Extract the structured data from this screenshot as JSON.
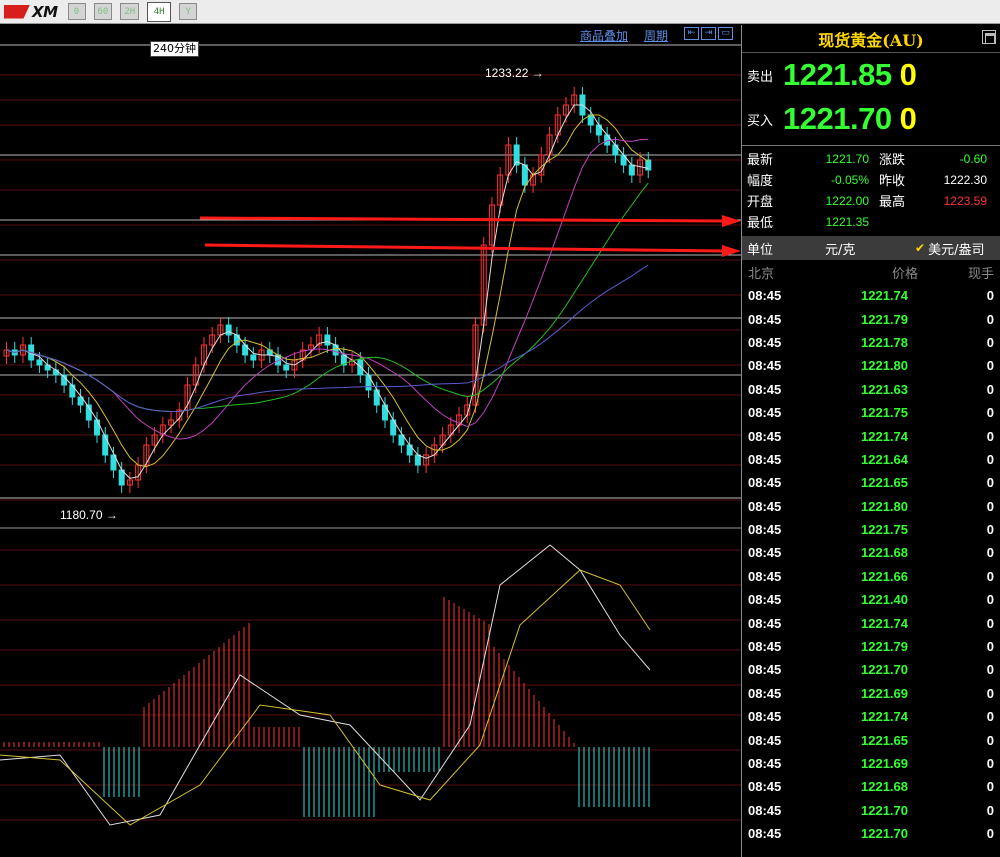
{
  "app": {
    "logo_text": "XM"
  },
  "toolbar": {
    "buttons": [
      "0",
      "60",
      "2H",
      "4H",
      "Y"
    ],
    "active": "4H"
  },
  "chart": {
    "period_tip": "240分钟",
    "links": [
      "商品叠加",
      "周期"
    ],
    "icon_names": [
      "scroll-left-icon",
      "scroll-right-icon",
      "zoom-out-icon"
    ],
    "high_label": "1233.22",
    "low_label": "1180.70"
  },
  "panel": {
    "title": "现货黄金(AU)",
    "sell_label": "卖出",
    "sell_price": "1221.85",
    "sell_vol": "0",
    "buy_label": "买入",
    "buy_price": "1221.70",
    "buy_vol": "0",
    "stats": {
      "latest_label": "最新",
      "latest": "1221.70",
      "change_label": "涨跌",
      "change": "-0.60",
      "range_label": "幅度",
      "range": "-0.05%",
      "prev_close_label": "昨收",
      "prev_close": "1222.30",
      "open_label": "开盘",
      "open": "1222.00",
      "high_label": "最高",
      "high": "1223.59",
      "low_label": "最低",
      "low": "1221.35"
    },
    "unit": {
      "label": "单位",
      "yuan": "元/克",
      "usd": "美元/盎司"
    },
    "tick_header": {
      "time": "北京",
      "price": "价格",
      "vol": "现手"
    },
    "ticks": [
      {
        "time": "08:45",
        "price": "1221.74",
        "vol": "0"
      },
      {
        "time": "08:45",
        "price": "1221.79",
        "vol": "0"
      },
      {
        "time": "08:45",
        "price": "1221.78",
        "vol": "0"
      },
      {
        "time": "08:45",
        "price": "1221.80",
        "vol": "0"
      },
      {
        "time": "08:45",
        "price": "1221.63",
        "vol": "0"
      },
      {
        "time": "08:45",
        "price": "1221.75",
        "vol": "0"
      },
      {
        "time": "08:45",
        "price": "1221.74",
        "vol": "0"
      },
      {
        "time": "08:45",
        "price": "1221.64",
        "vol": "0"
      },
      {
        "time": "08:45",
        "price": "1221.65",
        "vol": "0"
      },
      {
        "time": "08:45",
        "price": "1221.80",
        "vol": "0"
      },
      {
        "time": "08:45",
        "price": "1221.75",
        "vol": "0"
      },
      {
        "time": "08:45",
        "price": "1221.68",
        "vol": "0"
      },
      {
        "time": "08:45",
        "price": "1221.66",
        "vol": "0"
      },
      {
        "time": "08:45",
        "price": "1221.40",
        "vol": "0"
      },
      {
        "time": "08:45",
        "price": "1221.74",
        "vol": "0"
      },
      {
        "time": "08:45",
        "price": "1221.79",
        "vol": "0"
      },
      {
        "time": "08:45",
        "price": "1221.70",
        "vol": "0"
      },
      {
        "time": "08:45",
        "price": "1221.69",
        "vol": "0"
      },
      {
        "time": "08:45",
        "price": "1221.74",
        "vol": "0"
      },
      {
        "time": "08:45",
        "price": "1221.65",
        "vol": "0"
      },
      {
        "time": "08:45",
        "price": "1221.69",
        "vol": "0"
      },
      {
        "time": "08:45",
        "price": "1221.68",
        "vol": "0"
      },
      {
        "time": "08:45",
        "price": "1221.70",
        "vol": "0"
      },
      {
        "time": "08:45",
        "price": "1221.70",
        "vol": "0"
      }
    ]
  },
  "colors": {
    "up": "#ff3333",
    "down": "#33dddd",
    "ma5": "#e0e0e0",
    "ma10": "#d4c030",
    "ma20": "#c040c0",
    "ma30": "#20c020",
    "ma60": "#5a5ad0",
    "price_green": "#33ff33",
    "title_gold": "#ffd700",
    "arrow": "#ff1a1a"
  }
}
